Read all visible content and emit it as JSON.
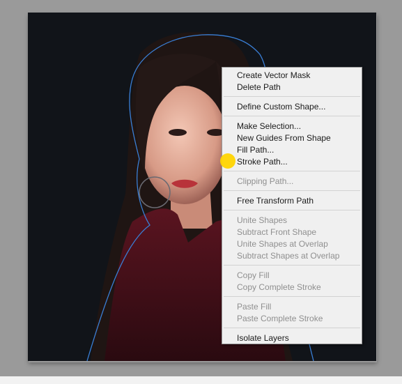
{
  "menu": {
    "create_vector_mask": "Create Vector Mask",
    "delete_path": "Delete Path",
    "define_custom_shape": "Define Custom Shape...",
    "make_selection": "Make Selection...",
    "new_guides_from_shape": "New Guides From Shape",
    "fill_path": "Fill Path...",
    "stroke_path": "Stroke Path...",
    "clipping_path": "Clipping Path...",
    "free_transform_path": "Free Transform Path",
    "unite_shapes": "Unite Shapes",
    "subtract_front_shape": "Subtract Front Shape",
    "unite_shapes_at_overlap": "Unite Shapes at Overlap",
    "subtract_shapes_at_overlap": "Subtract Shapes at Overlap",
    "copy_fill": "Copy Fill",
    "copy_complete_stroke": "Copy Complete Stroke",
    "paste_fill": "Paste Fill",
    "paste_complete_stroke": "Paste Complete Stroke",
    "isolate_layers": "Isolate Layers"
  },
  "colors": {
    "workspace": "#9a9a9a",
    "canvas": "#111419",
    "path_outline": "#3a7fd6",
    "menu_background": "#f0f0f0",
    "disabled_text": "#8f8f8f",
    "cursor_highlight": "#ffd400"
  },
  "icons": {
    "cursor_highlight": "yellow-click-indicator"
  }
}
